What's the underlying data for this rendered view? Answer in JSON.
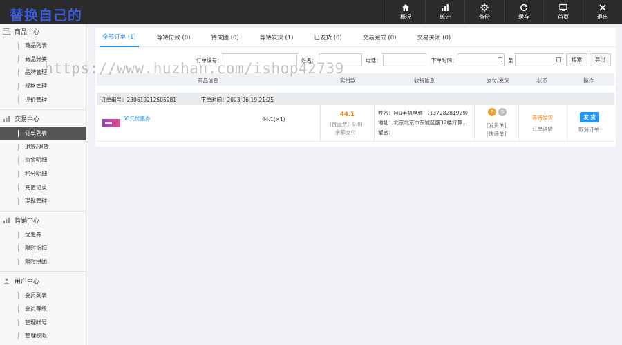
{
  "app": {
    "logo_text": "替换自己的"
  },
  "topnav": [
    {
      "label": "概况",
      "icon": "home-icon"
    },
    {
      "label": "统计",
      "icon": "bar-chart-icon"
    },
    {
      "label": "备份",
      "icon": "gear-icon"
    },
    {
      "label": "缓存",
      "icon": "refresh-icon"
    },
    {
      "label": "首页",
      "icon": "monitor-icon"
    },
    {
      "label": "退出",
      "icon": "close-icon"
    }
  ],
  "sidebar": {
    "groups": [
      {
        "title": "商品中心",
        "icon": "grid-icon",
        "items": [
          "商品列表",
          "商品分类",
          "品牌管理",
          "规格管理",
          "评价管理"
        ]
      },
      {
        "title": "交易中心",
        "icon": "chart-icon",
        "items": [
          "订单列表",
          "退款/退货",
          "资金明细",
          "积分明细",
          "充值记录",
          "提现管理"
        ]
      },
      {
        "title": "营销中心",
        "icon": "chart-icon",
        "items": [
          "优惠券",
          "限时折扣",
          "限时拼团"
        ]
      },
      {
        "title": "用户中心",
        "icon": "user-icon",
        "items": [
          "会员列表",
          "会员等级",
          "管理帐号",
          "管理权限"
        ]
      }
    ],
    "active_item": "订单列表"
  },
  "tabs": [
    {
      "label": "全部订单 (1)",
      "active": true
    },
    {
      "label": "等待付款 (0)",
      "active": false
    },
    {
      "label": "待成团 (0)",
      "active": false
    },
    {
      "label": "等待发货 (1)",
      "active": false
    },
    {
      "label": "已发货 (0)",
      "active": false
    },
    {
      "label": "交易完成 (0)",
      "active": false
    },
    {
      "label": "交易关闭 (0)",
      "active": false
    }
  ],
  "filters": {
    "order_no_label": "订单编号：",
    "name_label": "姓名：",
    "phone_label": "电话：",
    "order_time_label": "下单时间：",
    "to_label": "至",
    "search_button": "搜索",
    "export_button": "导出"
  },
  "table": {
    "headers": [
      "商品信息",
      "实付款",
      "收货信息",
      "支付/发货",
      "状态",
      "操作"
    ],
    "orders": [
      {
        "order_no_text": "订单编号：230619212505281",
        "order_time_text": "下单时间：2023-06-19 21:25",
        "product_name": "50元优惠券",
        "price_qty": "44.1(×1)",
        "paid_amount": "44.1",
        "shipping_fee": "(含运费：0.0)",
        "pay_method": "余额支付",
        "receiver_name": "姓名：阿u手机电脑 （13728281929）",
        "receiver_address": "地址：北京北京市东城区盛32楼打算...",
        "receiver_note": "留言：",
        "ship_link": "[发货单]",
        "express_link": "[快递单]",
        "status": "等待发货",
        "detail_link": "订单详情",
        "ship_button": "发 货",
        "cancel_link": "取消订单"
      }
    ]
  },
  "watermark": "https://www.huzhan.com/ishop42739",
  "colors": {
    "accent": "#1e88e5",
    "status_orange": "#f57c00",
    "price_orange": "#f57c00",
    "topbar": "#2b2b2b"
  }
}
